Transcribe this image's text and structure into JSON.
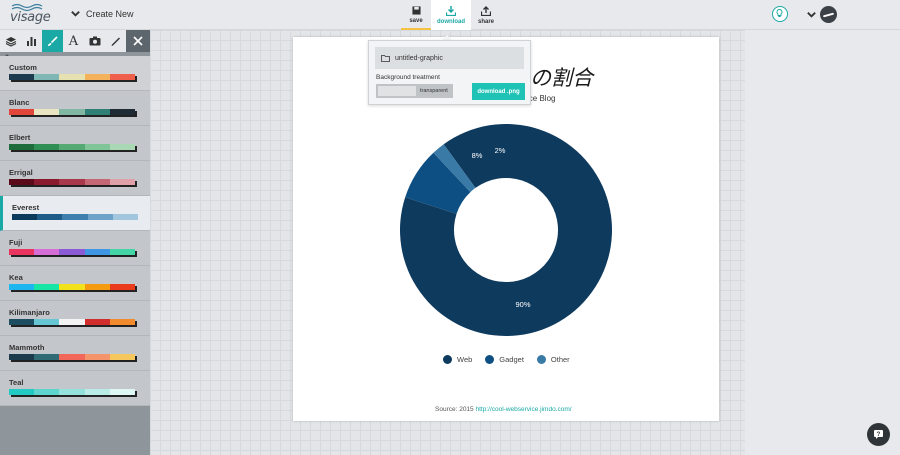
{
  "app": {
    "logo_text": "visage",
    "create_new_label": "Create New"
  },
  "toolbar": {
    "save_label": "save",
    "download_label": "download",
    "share_label": "share"
  },
  "sidebar": {
    "tools": [
      "layers-icon",
      "chart-icon",
      "brush-icon",
      "text-icon",
      "camera-icon",
      "pen-icon",
      "close-icon"
    ],
    "text_tool_glyph": "A",
    "themes": [
      {
        "name": "Custom",
        "colors": [
          "#1d3b4f",
          "#7fb7b5",
          "#e6e1b0",
          "#f4b35a",
          "#ef5f4c"
        ]
      },
      {
        "name": "Blanc",
        "colors": [
          "#e2463a",
          "#e9e4c1",
          "#7fb7a3",
          "#2f7f76",
          "#1e2b35"
        ]
      },
      {
        "name": "Elbert",
        "colors": [
          "#1e6b3c",
          "#2f8f55",
          "#55aa73",
          "#7fc597",
          "#aad8b4"
        ]
      },
      {
        "name": "Errigal",
        "colors": [
          "#5a0a19",
          "#8a1a2e",
          "#a8394a",
          "#c56775",
          "#e0a0a8"
        ]
      },
      {
        "name": "Everest",
        "colors": [
          "#0b3a5c",
          "#1f5c88",
          "#3f7fae",
          "#6ea3c9",
          "#a2c6de"
        ]
      },
      {
        "name": "Fuji",
        "colors": [
          "#e8345f",
          "#d56fd6",
          "#8a5bd4",
          "#3f96e3",
          "#43d6a4"
        ]
      },
      {
        "name": "Kea",
        "colors": [
          "#1eb6f0",
          "#17e5a5",
          "#f2e21c",
          "#f59b12",
          "#ea3b1c"
        ]
      },
      {
        "name": "Kilimanjaro",
        "colors": [
          "#1c4d61",
          "#66c6d3",
          "#f3f3f3",
          "#d22d2d",
          "#f28a2e"
        ]
      },
      {
        "name": "Mammoth",
        "colors": [
          "#1b3a4b",
          "#2f6a75",
          "#f2675a",
          "#f5946a",
          "#f6c75c"
        ]
      },
      {
        "name": "Teal",
        "colors": [
          "#22cac3",
          "#5dd4cd",
          "#94e1db",
          "#b9ece7",
          "#dcf7f4"
        ]
      }
    ],
    "selected_theme": "Everest"
  },
  "popup": {
    "filename": "untitled-graphic",
    "bg_label": "Background treatment",
    "bg_value": "transparent",
    "download_button": "download .png"
  },
  "chart_data": {
    "type": "pie",
    "title": "の割合",
    "subtitle": "ice Blog",
    "categories": [
      "Web",
      "Gadget",
      "Other"
    ],
    "values": [
      90,
      8,
      2
    ],
    "data_labels": [
      "90%",
      "8%",
      "2%"
    ],
    "colors": [
      "#0e3a5e",
      "#0d4f82",
      "#3a7aa7"
    ],
    "donut": true,
    "legend_position": "bottom",
    "source_prefix": "Source: 2015",
    "source_link": "http://cool-webservice.jimdo.com/"
  }
}
